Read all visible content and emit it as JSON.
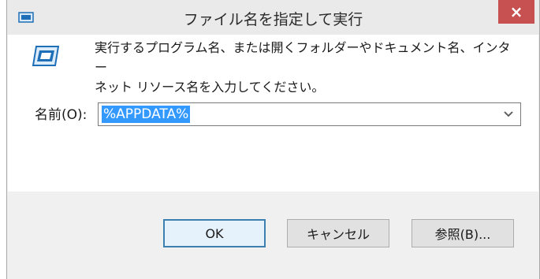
{
  "window": {
    "title": "ファイル名を指定して実行",
    "close_label": "×"
  },
  "description": {
    "line1": "実行するプログラム名、または開くフォルダーやドキュメント名、インター",
    "line2": "ネット リソース名を入力してください。"
  },
  "name_field": {
    "label": "名前(O):",
    "value": "%APPDATA%"
  },
  "buttons": {
    "ok": "OK",
    "cancel": "キャンセル",
    "browse": "参照(B)..."
  },
  "colors": {
    "close_bg": "#c75050",
    "selection": "#3399ff",
    "icon_blue": "#1e6fb8"
  }
}
